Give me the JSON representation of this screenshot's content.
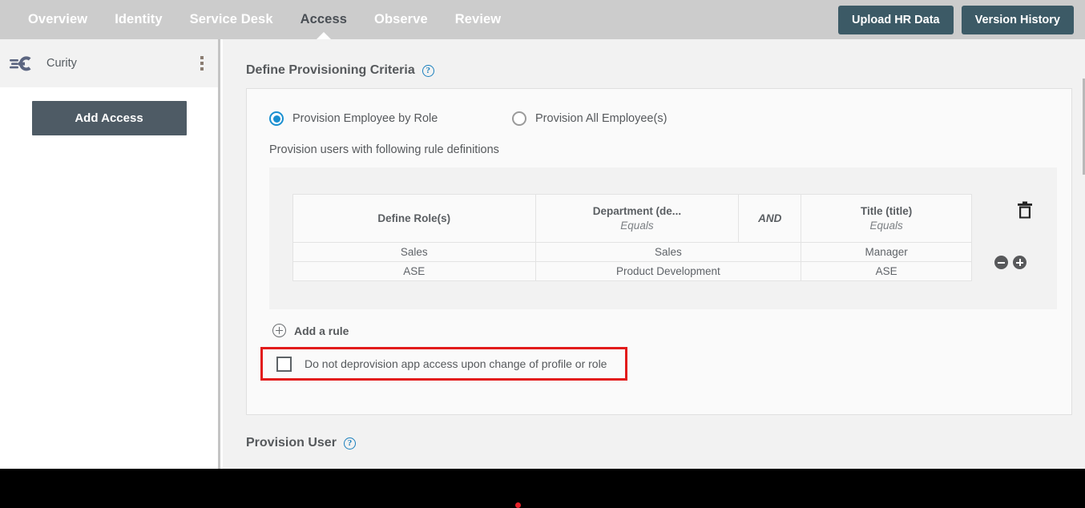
{
  "topnav": {
    "items": [
      {
        "label": "Overview",
        "active": false
      },
      {
        "label": "Identity",
        "active": false
      },
      {
        "label": "Service Desk",
        "active": false
      },
      {
        "label": "Access",
        "active": true
      },
      {
        "label": "Observe",
        "active": false
      },
      {
        "label": "Review",
        "active": false
      }
    ],
    "actions": {
      "upload_hr_data": "Upload HR Data",
      "version_history": "Version History"
    },
    "colors": {
      "bar_background": "#cccccc",
      "inactive_text": "#ffffff",
      "active_text": "#4a4f55",
      "button_background": "#3c5a66"
    }
  },
  "sidebar": {
    "app": {
      "logo_icon": "curity-logo-icon",
      "name": "Curity",
      "menu_icon": "kebab-menu-icon"
    },
    "add_access_button": "Add Access"
  },
  "main": {
    "section1_title": "Define Provisioning Criteria",
    "section1_help_icon": "help-circle-icon",
    "radios": [
      {
        "label": "Provision Employee by Role",
        "selected": true
      },
      {
        "label": "Provision All Employee(s)",
        "selected": false
      }
    ],
    "rule_intro": "Provision users with following rule definitions",
    "rule_table": {
      "headers": [
        {
          "title": "Define Role(s)",
          "operator": ""
        },
        {
          "title": "Department (de...",
          "operator": "Equals"
        },
        {
          "title": "AND",
          "operator": ""
        },
        {
          "title": "Title (title)",
          "operator": "Equals"
        }
      ],
      "rows": [
        {
          "role": "Sales",
          "department": "Sales",
          "title": "Manager"
        },
        {
          "role": "ASE",
          "department": "Product Development",
          "title": "ASE"
        }
      ]
    },
    "delete_icon": "trash-icon",
    "row_remove_icon": "minus-circle-icon",
    "row_add_icon": "plus-circle-icon",
    "add_rule": {
      "icon": "plus-circle-icon",
      "label": "Add a rule"
    },
    "deprovision_checkbox": {
      "label": "Do not deprovision app access upon change of profile or role",
      "checked": false,
      "highlight_color": "#e21b1b"
    },
    "section2_title": "Provision User",
    "section2_help_icon": "help-circle-icon"
  },
  "bottom": {
    "cursor_marker_color": "#e8232a"
  }
}
